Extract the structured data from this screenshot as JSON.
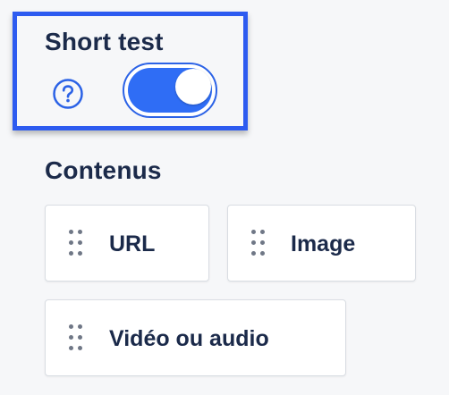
{
  "short_test": {
    "title": "Short test",
    "help_icon": "question-circle-icon",
    "toggle_on": true
  },
  "contents": {
    "title": "Contenus",
    "drag_icon": "drag-handle-icon",
    "items": [
      {
        "label": "URL"
      },
      {
        "label": "Image"
      },
      {
        "label": "Vidéo ou audio"
      }
    ]
  },
  "colors": {
    "highlight": "#2d5bf0",
    "toggle_on": "#2f6df5",
    "text": "#1b2a4a",
    "background": "#f6f7f9"
  }
}
